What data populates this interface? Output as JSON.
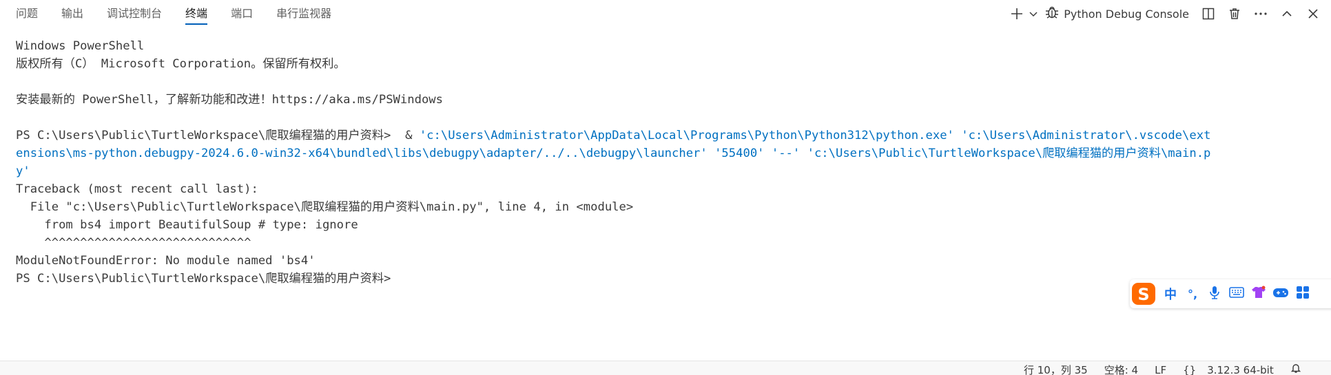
{
  "tabs": [
    {
      "label": "问题"
    },
    {
      "label": "输出"
    },
    {
      "label": "调试控制台"
    },
    {
      "label": "终端"
    },
    {
      "label": "端口"
    },
    {
      "label": "串行监视器"
    }
  ],
  "active_tab": "终端",
  "actions": {
    "new_terminal_icon": "plus-icon",
    "dropdown_icon": "chevron-down-icon",
    "terminal_profile_icon": "bug-icon",
    "terminal_name": "Python Debug Console",
    "split_icon": "split-panel-icon",
    "trash_icon": "trash-icon",
    "more_icon": "ellipsis-icon",
    "maximize_icon": "chevron-up-icon",
    "close_icon": "close-icon"
  },
  "terminal": {
    "lines": [
      "Windows PowerShell",
      "版权所有（C） Microsoft Corporation。保留所有权利。",
      "",
      "安装最新的 PowerShell，了解新功能和改进！https://aka.ms/PSWindows",
      "",
      "PS C:\\Users\\Public\\TurtleWorkspace\\爬取编程猫的用户资料>",
      "Traceback (most recent call last):",
      "  File \"c:\\Users\\Public\\TurtleWorkspace\\爬取编程猫的用户资料\\main.py\", line 4, in <module>",
      "    from bs4 import BeautifulSoup # type: ignore",
      "    ^^^^^^^^^^^^^^^^^^^^^^^^^^^^^",
      "ModuleNotFoundError: No module named 'bs4'",
      "PS C:\\Users\\Public\\TurtleWorkspace\\爬取编程猫的用户资料>"
    ],
    "command_amp": "  & ",
    "command_line1": "'c:\\Users\\Administrator\\AppData\\Local\\Programs\\Python\\Python312\\python.exe' 'c:\\Users\\Administrator\\.vscode\\ext",
    "command_line2": "ensions\\ms-python.debugpy-2024.6.0-win32-x64\\bundled\\libs\\debugpy\\adapter/../..\\debugpy\\launcher' '55400' '--' 'c:\\Users\\Public\\TurtleWorkspace\\爬取编程猫的用户资料\\main.p",
    "command_line3": "y'"
  },
  "ime": {
    "logo_icon": "sogou-logo-icon",
    "mode_label": "中",
    "punct_label": "°,",
    "icons": [
      "microphone-icon",
      "keyboard-icon",
      "skin-icon",
      "game-icon",
      "apps-icon"
    ]
  },
  "status_bar": {
    "line_col": "行 10，列 35",
    "spaces": "空格: 4",
    "eol": "LF",
    "lang_icon": "braces-icon",
    "python_version": "3.12.3 64-bit",
    "bell_icon": "bell-icon"
  },
  "colors": {
    "active_tab_underline": "#005fb8",
    "command_text": "#0070c1",
    "ime_accent": "#ff6a00"
  }
}
